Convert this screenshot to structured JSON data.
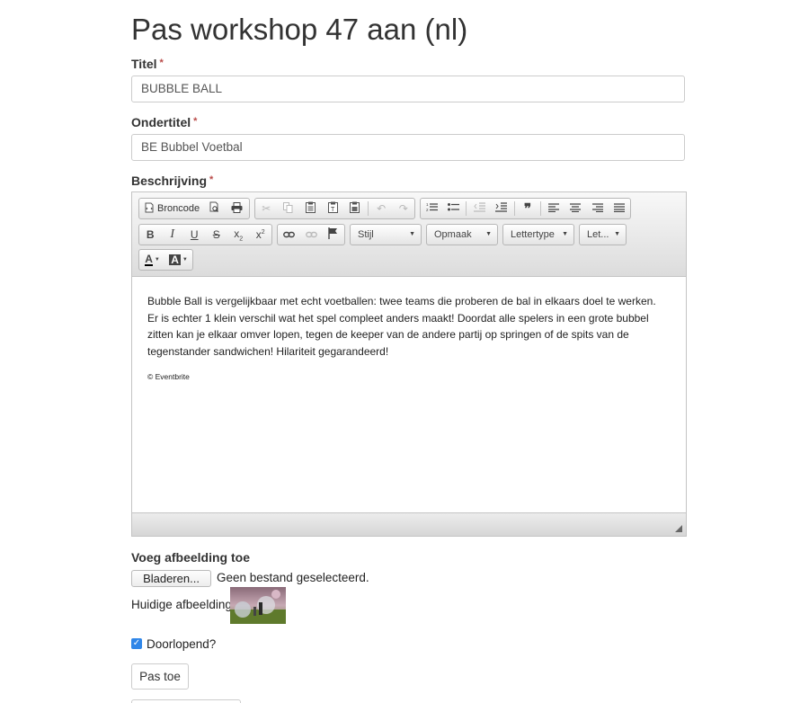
{
  "page": {
    "title": "Pas workshop 47 aan (nl)"
  },
  "fields": {
    "titel": {
      "label": "Titel",
      "required_mark": "*",
      "value": "BUBBLE BALL"
    },
    "ondertitel": {
      "label": "Ondertitel",
      "required_mark": "*",
      "value": "BE Bubbel Voetbal"
    },
    "beschrijving": {
      "label": "Beschrijving",
      "required_mark": "*"
    }
  },
  "editor": {
    "toolbar": {
      "source_label": "Broncode",
      "combos": {
        "style": "Stijl",
        "format": "Opmaak",
        "font": "Lettertype",
        "size": "Let..."
      },
      "icons": {
        "source": "source-icon",
        "preview": "preview-icon",
        "print": "print-icon",
        "cut": "cut-icon",
        "copy": "copy-icon",
        "paste": "paste-icon",
        "paste_text": "paste-text-icon",
        "paste_word": "paste-word-icon",
        "undo": "undo-icon",
        "redo": "redo-icon",
        "numbered_list": "numbered-list-icon",
        "bulleted_list": "bulleted-list-icon",
        "outdent": "outdent-icon",
        "indent": "indent-icon",
        "blockquote": "blockquote-icon",
        "align_left": "align-left-icon",
        "align_center": "align-center-icon",
        "align_right": "align-right-icon",
        "justify": "justify-icon",
        "bold": "bold-icon",
        "italic": "italic-icon",
        "underline": "underline-icon",
        "strike": "strikethrough-icon",
        "subscript": "subscript-icon",
        "superscript": "superscript-icon",
        "link": "link-icon",
        "unlink": "unlink-icon",
        "anchor": "anchor-flag-icon",
        "text_color": "text-color-icon",
        "bg_color": "background-color-icon"
      }
    },
    "content": {
      "paragraph": "Bubble Ball is vergelijkbaar met echt voetballen: twee teams die proberen de bal in elkaars doel te werken. Er is echter 1 klein verschil wat het spel compleet anders maakt! Doordat alle spelers in een grote bubbel zitten kan je elkaar omver lopen, tegen de keeper van de andere partij op springen of de spits van de tegenstander sandwichen! Hilariteit gegarandeerd!",
      "credit": "© Eventbrite"
    }
  },
  "image": {
    "label": "Voeg afbeelding toe",
    "browse_button": "Bladeren...",
    "no_file_text": "Geen bestand geselecteerd.",
    "current_label": "Huidige afbeelding:"
  },
  "ongoing": {
    "label": "Doorlopend?",
    "checked": true
  },
  "submit": {
    "label": "Pas toe"
  },
  "colors": {
    "checkbox": "#2f86e8",
    "required": "#b94a48"
  }
}
